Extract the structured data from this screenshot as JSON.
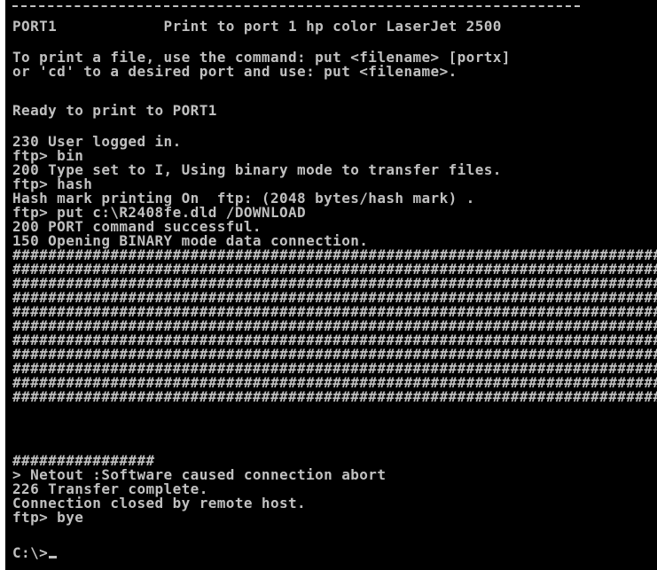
{
  "console": {
    "lines": [
      "PORT1            Print to port 1 hp color LaserJet 2500",
      "",
      "To print a file, use the command: put <filename> [portx]",
      "or 'cd' to a desired port and use: put <filename>.",
      "",
      "Ready to print to PORT1",
      "",
      "230 User logged in.",
      "ftp> bin",
      "200 Type set to I, Using binary mode to transfer files.",
      "ftp> hash",
      "Hash mark printing On  ftp: (2048 bytes/hash mark) .",
      "ftp> put c:\\R2408fe.dld /DOWNLOAD",
      "200 PORT command successful.",
      "150 Opening BINARY mode data connection.",
      "################################################################################",
      "################################################################################",
      "################################################################################",
      "################################################################################",
      "################################################################################",
      "################################################################################",
      "################################################################################",
      "################################################################################",
      "################################################################################",
      "################################################################################",
      "################################################################################",
      "################",
      "> Netout :Software caused connection abort",
      "226 Transfer complete.",
      "Connection closed by remote host.",
      "ftp> bye",
      "",
      "C:\\>"
    ]
  }
}
